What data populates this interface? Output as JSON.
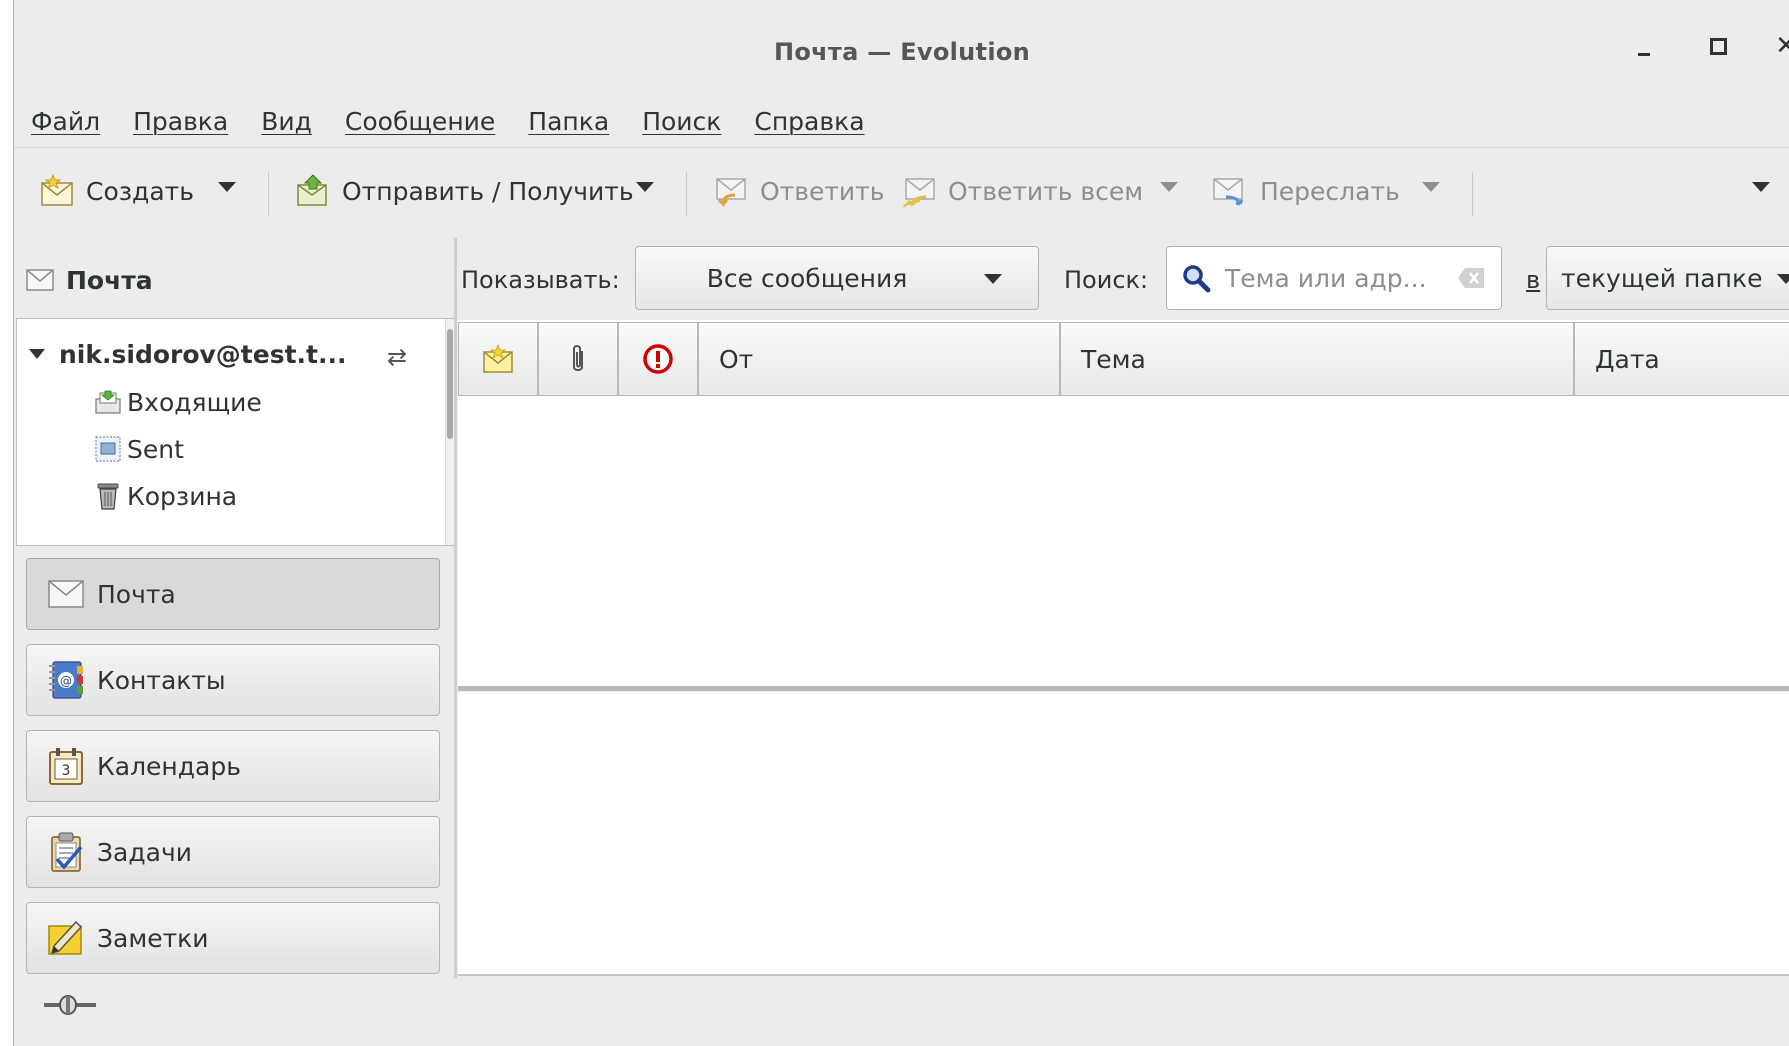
{
  "window": {
    "title": "Почта — Evolution",
    "controls": {
      "minimize": "_",
      "maximize": "□",
      "close": "×"
    }
  },
  "menu": [
    "Файл",
    "Правка",
    "Вид",
    "Сообщение",
    "Папка",
    "Поиск",
    "Справка"
  ],
  "toolbar": {
    "new_label": "Создать",
    "send_receive_label": "Отправить / Получить",
    "reply_label": "Ответить",
    "reply_all_label": "Ответить всем",
    "forward_label": "Переслать"
  },
  "sidebar": {
    "header": "Почта",
    "account": "nik.sidorov@test.t...",
    "folders": [
      "Входящие",
      "Sent",
      "Корзина"
    ],
    "switcher": [
      "Почта",
      "Контакты",
      "Календарь",
      "Задачи",
      "Заметки"
    ]
  },
  "filter": {
    "show_label": "Показывать:",
    "show_value": "Все сообщения",
    "search_label": "Поиск:",
    "search_placeholder": "Тема или адр...",
    "in_label": "в",
    "scope_value": "текущей папке"
  },
  "columns": {
    "from": "От",
    "subject": "Тема",
    "date": "Дата"
  },
  "colors": {
    "window_bg": "#ececec",
    "text": "#2e3436",
    "disabled_text": "#8a8f8f",
    "important_red": "#cc0000"
  }
}
